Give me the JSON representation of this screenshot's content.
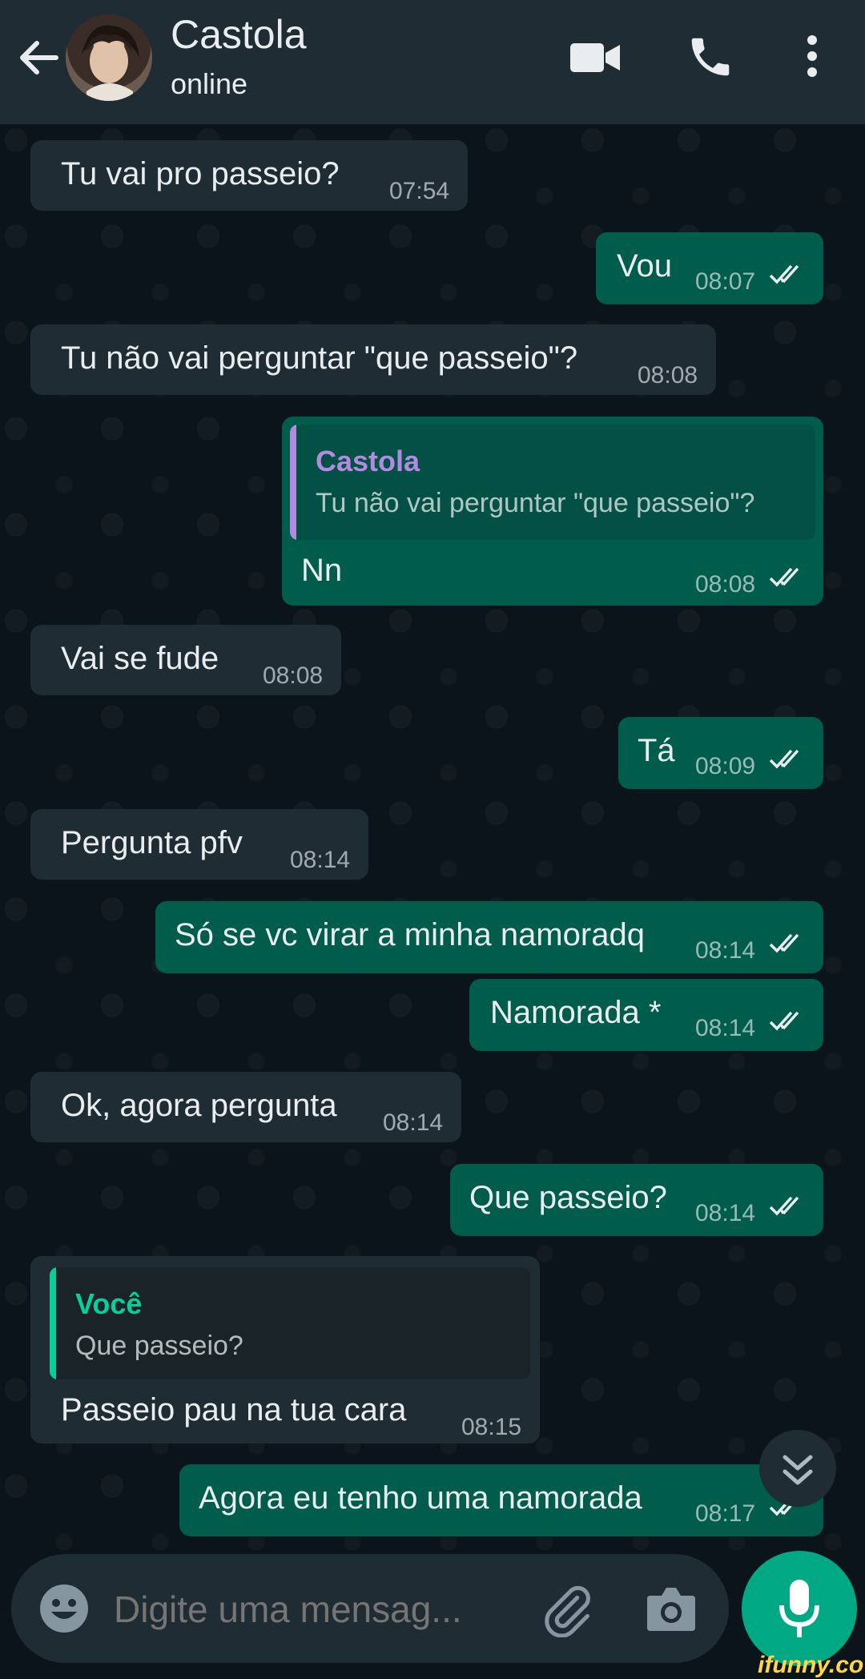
{
  "header": {
    "contact_name": "Castola",
    "status": "online",
    "icons": [
      "back-arrow-icon",
      "video-call-icon",
      "voice-call-icon",
      "more-options-icon"
    ]
  },
  "messages": [
    {
      "direction": "in",
      "text": "Tu vai pro passeio?",
      "time": "07:54"
    },
    {
      "direction": "out",
      "text": "Vou",
      "time": "08:07",
      "read": true
    },
    {
      "direction": "in",
      "text": "Tu não vai perguntar \"que passeio\"?",
      "time": "08:08"
    },
    {
      "direction": "out",
      "text": "Nn",
      "time": "08:08",
      "read": true,
      "reply_to": {
        "author": "Castola",
        "text": "Tu não vai perguntar \"que passeio\"?"
      }
    },
    {
      "direction": "in",
      "text": "Vai se fude",
      "time": "08:08"
    },
    {
      "direction": "out",
      "text": "Tá",
      "time": "08:09",
      "read": true
    },
    {
      "direction": "in",
      "text": "Pergunta pfv",
      "time": "08:14"
    },
    {
      "direction": "out",
      "text": "Só se vc virar a minha namoradq",
      "time": "08:14",
      "read": true
    },
    {
      "direction": "out",
      "text": "Namorada *",
      "time": "08:14",
      "read": true
    },
    {
      "direction": "in",
      "text": "Ok, agora pergunta",
      "time": "08:14"
    },
    {
      "direction": "out",
      "text": "Que passeio?",
      "time": "08:14",
      "read": true
    },
    {
      "direction": "in",
      "text": "Passeio pau na tua cara",
      "time": "08:15",
      "reply_to": {
        "author": "Você",
        "text": "Que passeio?"
      }
    },
    {
      "direction": "out",
      "text": "Agora eu tenho uma namorada",
      "time": "08:17",
      "read": true
    }
  ],
  "composer": {
    "placeholder": "Digite uma mensag...",
    "icons": [
      "emoji-icon",
      "attach-icon",
      "camera-icon",
      "microphone-icon"
    ]
  },
  "watermark": "ifunny.co",
  "colors": {
    "background": "#0b141a",
    "header": "#1f2c34",
    "incoming_bubble": "#1f2c34",
    "outgoing_bubble": "#005c4b",
    "accent": "#00a884",
    "read_tick": "#e9edef",
    "quote_castola": "#b28ae0",
    "quote_voce": "#06cf9c"
  }
}
